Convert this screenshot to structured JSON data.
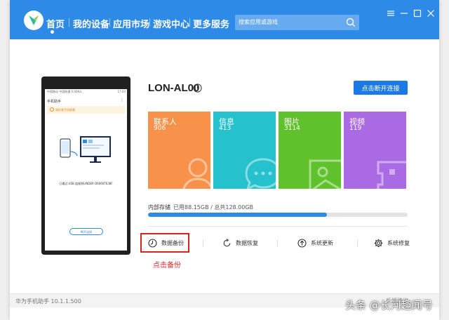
{
  "nav": {
    "items": [
      "首页",
      "我的设备",
      "应用市场",
      "游戏中心",
      "更多服务"
    ],
    "search_placeholder": "搜索应用或游戏"
  },
  "phone_preview": {
    "status_left": "中国移动 中国联通 0.00K/s",
    "status_right": "17:04",
    "title": "手机助手",
    "warning": "请检查手机屏幕",
    "caption": "已通过 USB 连接到LINDER D6060T638F",
    "button": "断开连接"
  },
  "device": {
    "name": "LON-AL00",
    "disconnect_label": "点击断开连接"
  },
  "tiles": [
    {
      "label": "联系人",
      "count": "906",
      "color": "#f8924b",
      "icon": "contacts-icon"
    },
    {
      "label": "信息",
      "count": "413",
      "color": "#25c1cc",
      "icon": "message-icon"
    },
    {
      "label": "图片",
      "count": "3114",
      "color": "#5fc22d",
      "icon": "picture-icon"
    },
    {
      "label": "视频",
      "count": "119",
      "color": "#a96ae3",
      "icon": "video-icon"
    }
  ],
  "storage": {
    "label": "内部存储",
    "used_text": "已用88.15GB / 总共128.00GB",
    "used_fraction": 0.689
  },
  "actions": [
    {
      "label": "数据备份",
      "icon": "backup-icon"
    },
    {
      "label": "数据恢复",
      "icon": "restore-icon"
    },
    {
      "label": "系统更新",
      "icon": "update-icon"
    },
    {
      "label": "系统修复",
      "icon": "repair-icon"
    }
  ],
  "annotation": "点击备份",
  "footer": {
    "version": "华为手机助手 10.1.1.500",
    "right": "反馈建议"
  },
  "watermark": "头条 @长河趣闻号",
  "colors": {
    "topbar": "#2d8ae6",
    "primary_button": "#1a79e6",
    "highlight": "#d9231d"
  }
}
